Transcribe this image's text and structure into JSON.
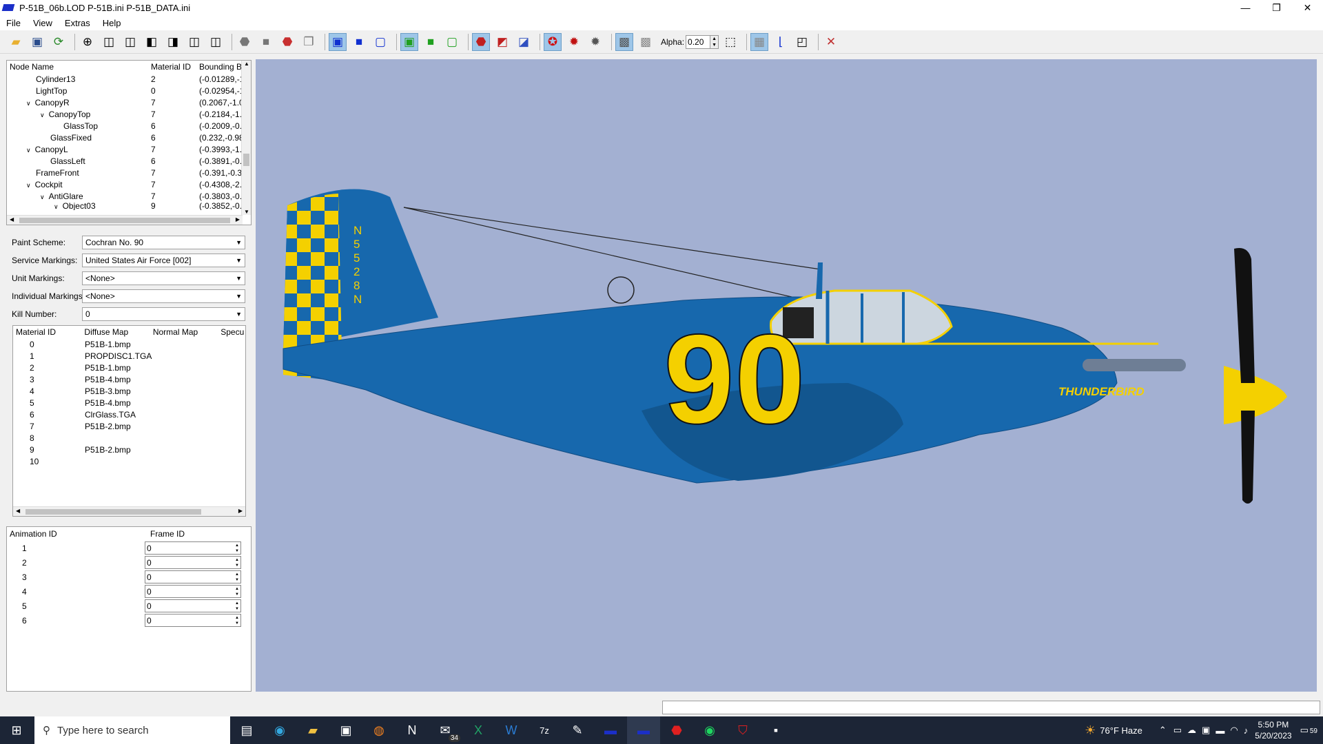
{
  "window": {
    "title": "P-51B_06b.LOD  P-51B.ini  P-51B_DATA.ini",
    "min": "—",
    "max": "❐",
    "close": "✕"
  },
  "menu": [
    "File",
    "View",
    "Extras",
    "Help"
  ],
  "toolbar": {
    "alpha_label": "Alpha:",
    "alpha_value": "0.20"
  },
  "node_tree": {
    "headers": [
      "Node Name",
      "Material ID",
      "Bounding B"
    ],
    "rows": [
      {
        "name": "Cylinder13",
        "mat": "2",
        "bb": "(-0.01289,-1."
      },
      {
        "name": "LightTop",
        "mat": "0",
        "bb": "(-0.02954,-1."
      },
      {
        "name": "CanopyR",
        "mat": "7",
        "bb": "(0.2067,-1.01"
      },
      {
        "name": "CanopyTop",
        "mat": "7",
        "bb": "(-0.2184,-1.0"
      },
      {
        "name": "GlassTop",
        "mat": "6",
        "bb": "(-0.2009,-0.9"
      },
      {
        "name": "GlassFixed",
        "mat": "6",
        "bb": "(0.232,-0.989"
      },
      {
        "name": "CanopyL",
        "mat": "7",
        "bb": "(-0.3993,-1.0"
      },
      {
        "name": "GlassLeft",
        "mat": "6",
        "bb": "(-0.3891,-0.9"
      },
      {
        "name": "FrameFront",
        "mat": "7",
        "bb": "(-0.391,-0.30"
      },
      {
        "name": "Cockpit",
        "mat": "7",
        "bb": "(-0.4308,-2.4"
      },
      {
        "name": "AntiGlare",
        "mat": "7",
        "bb": "(-0.3803,-0.0"
      },
      {
        "name": "Object03",
        "mat": "9",
        "bb": "(-0.3852,-0.0"
      }
    ]
  },
  "markings": {
    "paint_label": "Paint Scheme:",
    "paint_value": "Cochran No. 90",
    "service_label": "Service Markings:",
    "service_value": "United States Air Force [002]",
    "unit_label": "Unit Markings:",
    "unit_value": "<None>",
    "individual_label": "Individual Markings:",
    "individual_value": "<None>",
    "kill_label": "Kill Number:",
    "kill_value": "0"
  },
  "materials": {
    "headers": [
      "Material ID",
      "Diffuse Map",
      "Normal Map",
      "Specu"
    ],
    "rows": [
      {
        "id": "0",
        "diffuse": "P51B-1.bmp"
      },
      {
        "id": "1",
        "diffuse": "PROPDISC1.TGA"
      },
      {
        "id": "2",
        "diffuse": "P51B-1.bmp"
      },
      {
        "id": "3",
        "diffuse": "P51B-4.bmp"
      },
      {
        "id": "4",
        "diffuse": "P51B-3.bmp"
      },
      {
        "id": "5",
        "diffuse": "P51B-4.bmp"
      },
      {
        "id": "6",
        "diffuse": "ClrGlass.TGA"
      },
      {
        "id": "7",
        "diffuse": "P51B-2.bmp"
      },
      {
        "id": "8",
        "diffuse": ""
      },
      {
        "id": "9",
        "diffuse": "P51B-2.bmp"
      },
      {
        "id": "10",
        "diffuse": ""
      }
    ]
  },
  "animations": {
    "headers": [
      "Animation ID",
      "Frame ID"
    ],
    "rows": [
      {
        "id": "1",
        "frame": "0"
      },
      {
        "id": "2",
        "frame": "0"
      },
      {
        "id": "3",
        "frame": "0"
      },
      {
        "id": "4",
        "frame": "0"
      },
      {
        "id": "5",
        "frame": "0"
      },
      {
        "id": "6",
        "frame": "0"
      }
    ]
  },
  "aircraft": {
    "tail_reg": [
      "N",
      "5",
      "5",
      "2",
      "8",
      "N"
    ],
    "race_number": "90",
    "nose_name": "THUNDERBIRD",
    "fuselage_color": "#1768ad",
    "marking_color": "#f4d000"
  },
  "taskbar": {
    "search_placeholder": "Type here to search",
    "mail_badge": "34",
    "weather": "76°F  Haze",
    "time": "5:50 PM",
    "date": "5/20/2023",
    "notif_count": "59"
  }
}
